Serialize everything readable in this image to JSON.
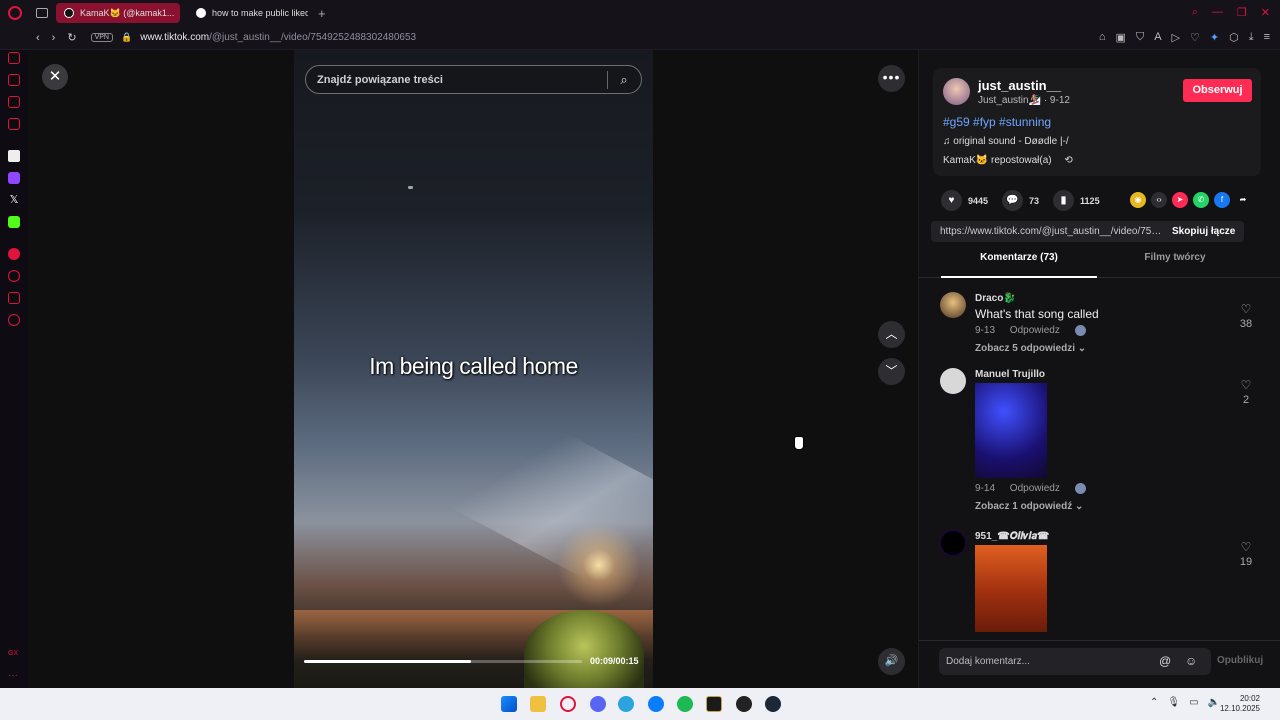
{
  "browser": {
    "tabs": [
      {
        "label": "KamaK🐱 (@kamak1...",
        "active": true
      },
      {
        "label": "how to make public liked",
        "active": false
      }
    ],
    "new_tab": "+",
    "vpn": "VPN",
    "url_host": "www.tiktok.com",
    "url_path": "/@just_austin__/video/7549252488302480653"
  },
  "video": {
    "search_placeholder": "Znajdź powiązane treści",
    "caption": "Im being called home",
    "time": "00:09/00:15",
    "progress": 0.6
  },
  "author": {
    "name": "just_austin__",
    "sub": "Just_austin🏂 · 9-12",
    "follow": "Obserwuj",
    "hashtags": "#g59 #fyp #stunning",
    "sound": "♫  original sound - Døødle |-/",
    "repost": "KamaK🐱 repostował(a)"
  },
  "stats": {
    "likes": "9445",
    "comments": "73",
    "saves": "1125"
  },
  "link": {
    "url": "https://www.tiktok.com/@just_austin__/video/754...",
    "copy": "Skopiuj łącze"
  },
  "tabs": {
    "comments": "Komentarze (73)",
    "creator": "Filmy twórcy"
  },
  "comments": [
    {
      "user": "Draco🐉",
      "text": "What's that song called",
      "date": "9-13",
      "reply": "Odpowiedz",
      "likes": "38",
      "more": "Zobacz 5 odpowiedzi ⌄"
    },
    {
      "user": "Manuel Trujillo",
      "text": "",
      "date": "9-14",
      "reply": "Odpowiedz",
      "likes": "2",
      "more": "Zobacz 1 odpowiedź ⌄"
    },
    {
      "user": "951_☎𝑶𝒍𝒊𝒗𝒊𝒂☎",
      "text": "",
      "date": "",
      "reply": "",
      "likes": "19",
      "more": ""
    }
  ],
  "comment_input": {
    "placeholder": "Dodaj komentarz...",
    "publish": "Opublikuj"
  },
  "taskbar": {
    "time": "20:02",
    "date": "12.10.2025"
  },
  "colors": {
    "accent": "#fe2c55",
    "opera": "#e0143c",
    "hashtag": "#6ea6ff"
  }
}
